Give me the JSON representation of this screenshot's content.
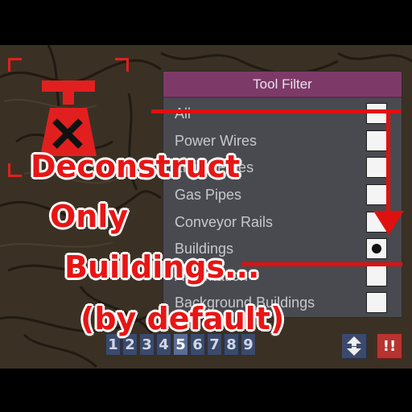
{
  "tool_filter": {
    "title": "Tool Filter",
    "options": [
      {
        "label": "All",
        "selected": false
      },
      {
        "label": "Power Wires",
        "selected": false
      },
      {
        "label": "Liquid Pipes",
        "selected": false
      },
      {
        "label": "Gas Pipes",
        "selected": false
      },
      {
        "label": "Conveyor Rails",
        "selected": false
      },
      {
        "label": "Buildings",
        "selected": true
      },
      {
        "label": "Automation",
        "selected": false
      },
      {
        "label": "Background Buildings",
        "selected": false
      }
    ]
  },
  "hotbar": {
    "keys": [
      "1",
      "2",
      "3",
      "4",
      "5",
      "6",
      "7",
      "8",
      "9"
    ],
    "active_key": "5",
    "alert_label": "!!"
  },
  "caption": {
    "line1": "Deconstruct",
    "line2": "Only",
    "line3": "Buildings...",
    "line4": "(by default)"
  },
  "colors": {
    "accent_red": "#e01010",
    "panel_header": "#7d3a68",
    "panel_body": "#494a4f",
    "hotkey_bg": "#3b4a6b"
  },
  "icons": {
    "tool": "deconstruct-icon",
    "swap": "swap-arrows-icon"
  }
}
